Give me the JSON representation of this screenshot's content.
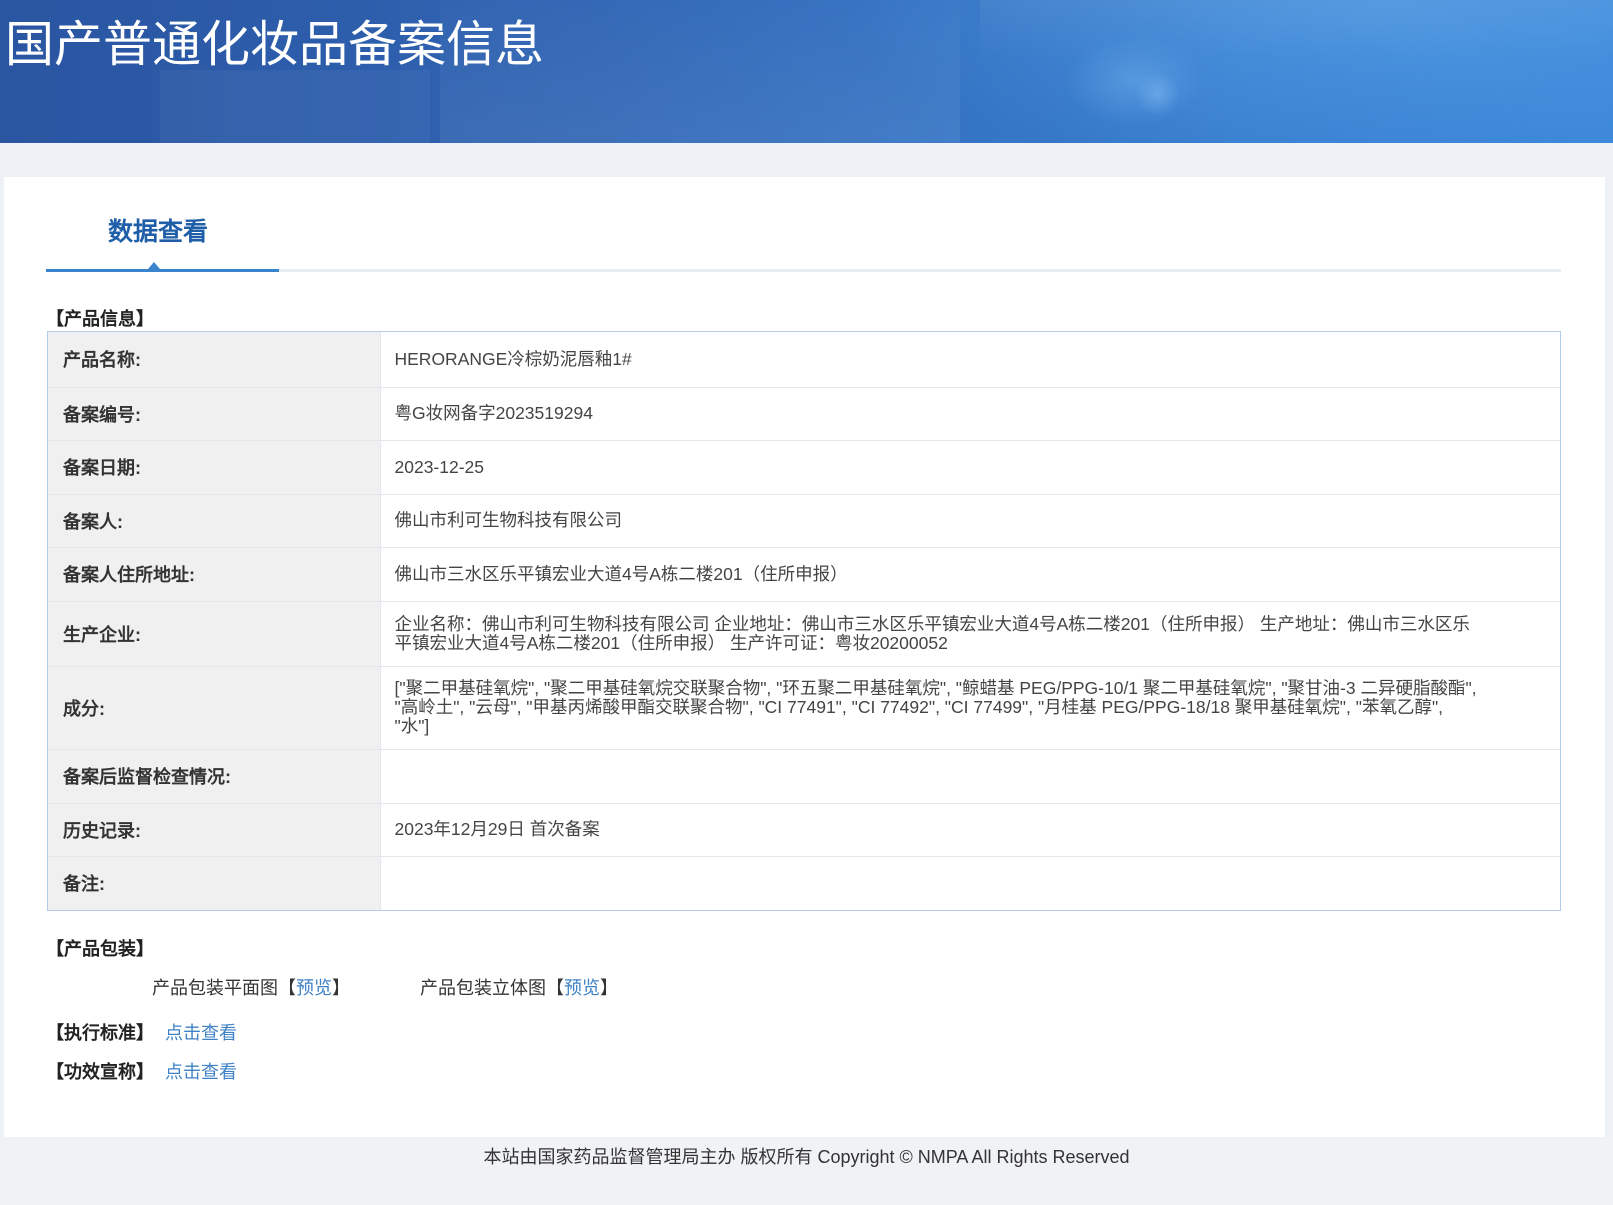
{
  "header": {
    "title": "国产普通化妆品备案信息"
  },
  "tabs": [
    {
      "label": "数据查看",
      "active": true
    }
  ],
  "product_info": {
    "section_title": "【产品信息】",
    "rows": [
      {
        "label": "产品名称:",
        "value": "HERORANGE冷棕奶泥唇釉1#"
      },
      {
        "label": "备案编号:",
        "value": "粤G妆网备字2023519294"
      },
      {
        "label": "备案日期:",
        "value": "2023-12-25"
      },
      {
        "label": "备案人:",
        "value": "佛山市利可生物科技有限公司"
      },
      {
        "label": "备案人住所地址:",
        "value": "佛山市三水区乐平镇宏业大道4号A栋二楼201（住所申报）"
      },
      {
        "label": "生产企业:",
        "value": "企业名称：佛山市利可生物科技有限公司 企业地址：佛山市三水区乐平镇宏业大道4号A栋二楼201（住所申报） 生产地址：佛山市三水区乐平镇宏业大道4号A栋二楼201（住所申报） 生产许可证：粤妆20200052"
      },
      {
        "label": "成分:",
        "value": "[\"聚二甲基硅氧烷\", \"聚二甲基硅氧烷交联聚合物\", \"环五聚二甲基硅氧烷\", \"鲸蜡基 PEG/PPG-10/1 聚二甲基硅氧烷\", \"聚甘油-3 二异硬脂酸酯\", \"高岭土\", \"云母\", \"甲基丙烯酸甲酯交联聚合物\", \"CI 77491\", \"CI 77492\", \"CI 77499\", \"月桂基 PEG/PPG-18/18 聚甲基硅氧烷\", \"苯氧乙醇\", \"水\"]"
      },
      {
        "label": "备案后监督检查情况:",
        "value": ""
      },
      {
        "label": "历史记录:",
        "value": "2023年12月29日 首次备案"
      },
      {
        "label": "备注:",
        "value": ""
      }
    ]
  },
  "packaging": {
    "section_title": "【产品包装】",
    "items": [
      {
        "label": "产品包装平面图",
        "open": "【",
        "link": "预览",
        "close": "】"
      },
      {
        "label": "产品包装立体图",
        "open": "【",
        "link": "预览",
        "close": "】"
      }
    ]
  },
  "standards": {
    "label": "【执行标准】",
    "link": "点击查看"
  },
  "efficacy": {
    "label": "【功效宣称】",
    "link": "点击查看"
  },
  "footer": {
    "text": "本站由国家药品监督管理局主办 版权所有 Copyright © NMPA All Rights Reserved"
  },
  "colors": {
    "header_blue": "#3472c2",
    "tab_active": "#1f5ea8",
    "link": "#3f82c6",
    "table_border": "#b2cbe6",
    "label_bg": "#f0f0f0"
  }
}
